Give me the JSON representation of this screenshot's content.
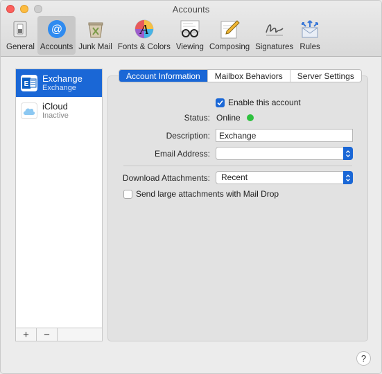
{
  "window": {
    "title": "Accounts"
  },
  "toolbar": {
    "items": [
      {
        "label": "General",
        "icon": "switch-icon"
      },
      {
        "label": "Accounts",
        "icon": "at-sign-icon"
      },
      {
        "label": "Junk Mail",
        "icon": "trash-bin-icon"
      },
      {
        "label": "Fonts & Colors",
        "icon": "font-color-icon"
      },
      {
        "label": "Viewing",
        "icon": "glasses-icon"
      },
      {
        "label": "Composing",
        "icon": "pencil-icon"
      },
      {
        "label": "Signatures",
        "icon": "signature-icon"
      },
      {
        "label": "Rules",
        "icon": "envelope-arrows-icon"
      }
    ],
    "active": "Accounts"
  },
  "accounts": [
    {
      "name": "Exchange",
      "subtitle": "Exchange",
      "icon": "exchange-icon"
    },
    {
      "name": "iCloud",
      "subtitle": "Inactive",
      "icon": "icloud-icon"
    }
  ],
  "footer": {
    "add": "+",
    "remove": "−"
  },
  "tabs": [
    {
      "label": "Account Information"
    },
    {
      "label": "Mailbox Behaviors"
    },
    {
      "label": "Server Settings"
    }
  ],
  "form": {
    "enable_label": "Enable this account",
    "enable_checked": true,
    "status_label": "Status:",
    "status_value": "Online",
    "status_color": "#2ec13f",
    "description_label": "Description:",
    "description_value": "Exchange",
    "email_label": "Email Address:",
    "email_value": "",
    "download_label": "Download Attachments:",
    "download_value": "Recent",
    "maildrop_label": "Send large attachments with Mail Drop",
    "maildrop_checked": false
  },
  "help": {
    "label": "?"
  },
  "colors": {
    "accent": "#1a67d6"
  }
}
